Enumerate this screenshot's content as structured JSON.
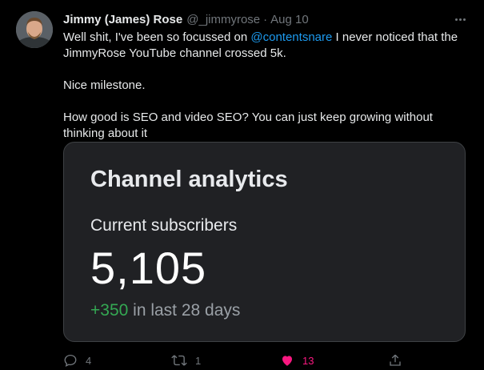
{
  "tweet": {
    "display_name": "Jimmy (James) Rose",
    "handle": "@_jimmyrose",
    "separator": "·",
    "date": "Aug 10",
    "text_line1_before": "Well shit, I've been so focussed on ",
    "mention": "@contentsnare",
    "text_line1_after": " I never noticed that the JimmyRose YouTube channel crossed 5k.",
    "text_para2": "Nice milestone.",
    "text_para3": "How good is SEO and video SEO? You can just keep growing without thinking about it"
  },
  "card": {
    "title": "Channel analytics",
    "subtitle": "Current subscribers",
    "subscribers": "5,105",
    "delta": "+350",
    "delta_suffix": " in last 28 days"
  },
  "actions": {
    "reply_count": "4",
    "retweet_count": "1",
    "like_count": "13"
  },
  "colors": {
    "accent_link": "#1d9bf0",
    "like": "#f91880",
    "growth": "#34a853"
  },
  "icons": [
    "more-icon",
    "reply-icon",
    "retweet-icon",
    "like-icon",
    "share-icon"
  ]
}
